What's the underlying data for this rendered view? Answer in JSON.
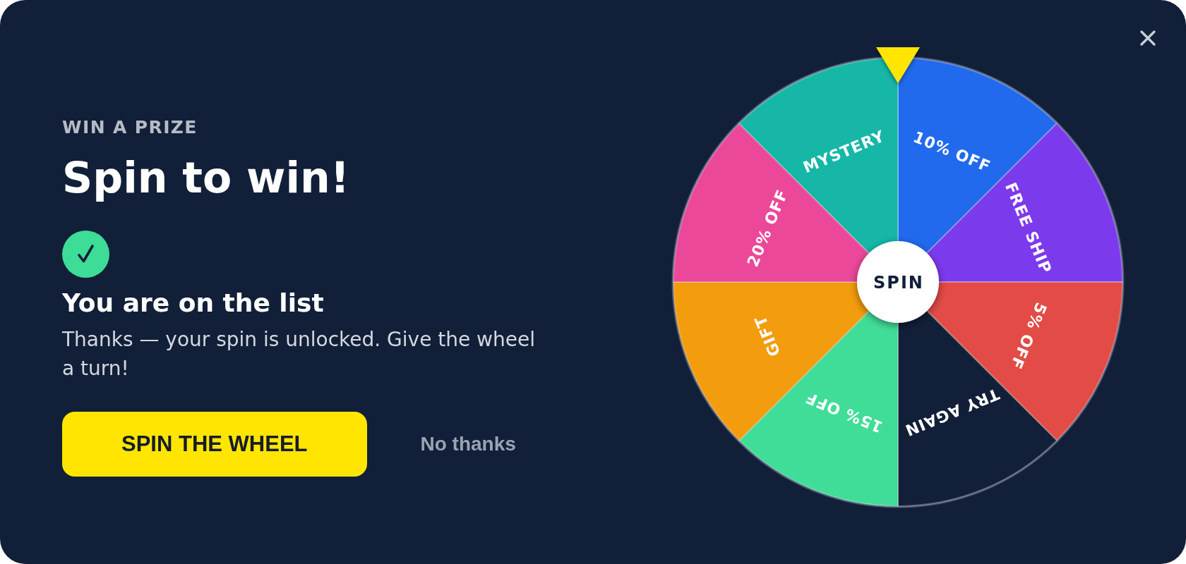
{
  "modal": {
    "eyebrow": "WIN A PRIZE",
    "title": "Spin to win!",
    "status_heading": "You are on the list",
    "message": "Thanks — your spin is unlocked. Give the wheel a turn!",
    "primary_button": "SPIN THE WHEEL",
    "secondary_link": "No thanks"
  },
  "wheel": {
    "hub_label": "SPIN",
    "segments": [
      {
        "label": "10% OFF",
        "color": "#216aed"
      },
      {
        "label": "FREE SHIP",
        "color": "#7c3aed"
      },
      {
        "label": "5% OFF",
        "color": "#e24b46"
      },
      {
        "label": "TRY AGAIN",
        "color": "#111f38"
      },
      {
        "label": "15% OFF",
        "color": "#40dd98"
      },
      {
        "label": "GIFT",
        "color": "#f39c0e"
      },
      {
        "label": "20% OFF",
        "color": "#eb4899"
      },
      {
        "label": "MYSTERY",
        "color": "#16b7a7"
      }
    ]
  }
}
